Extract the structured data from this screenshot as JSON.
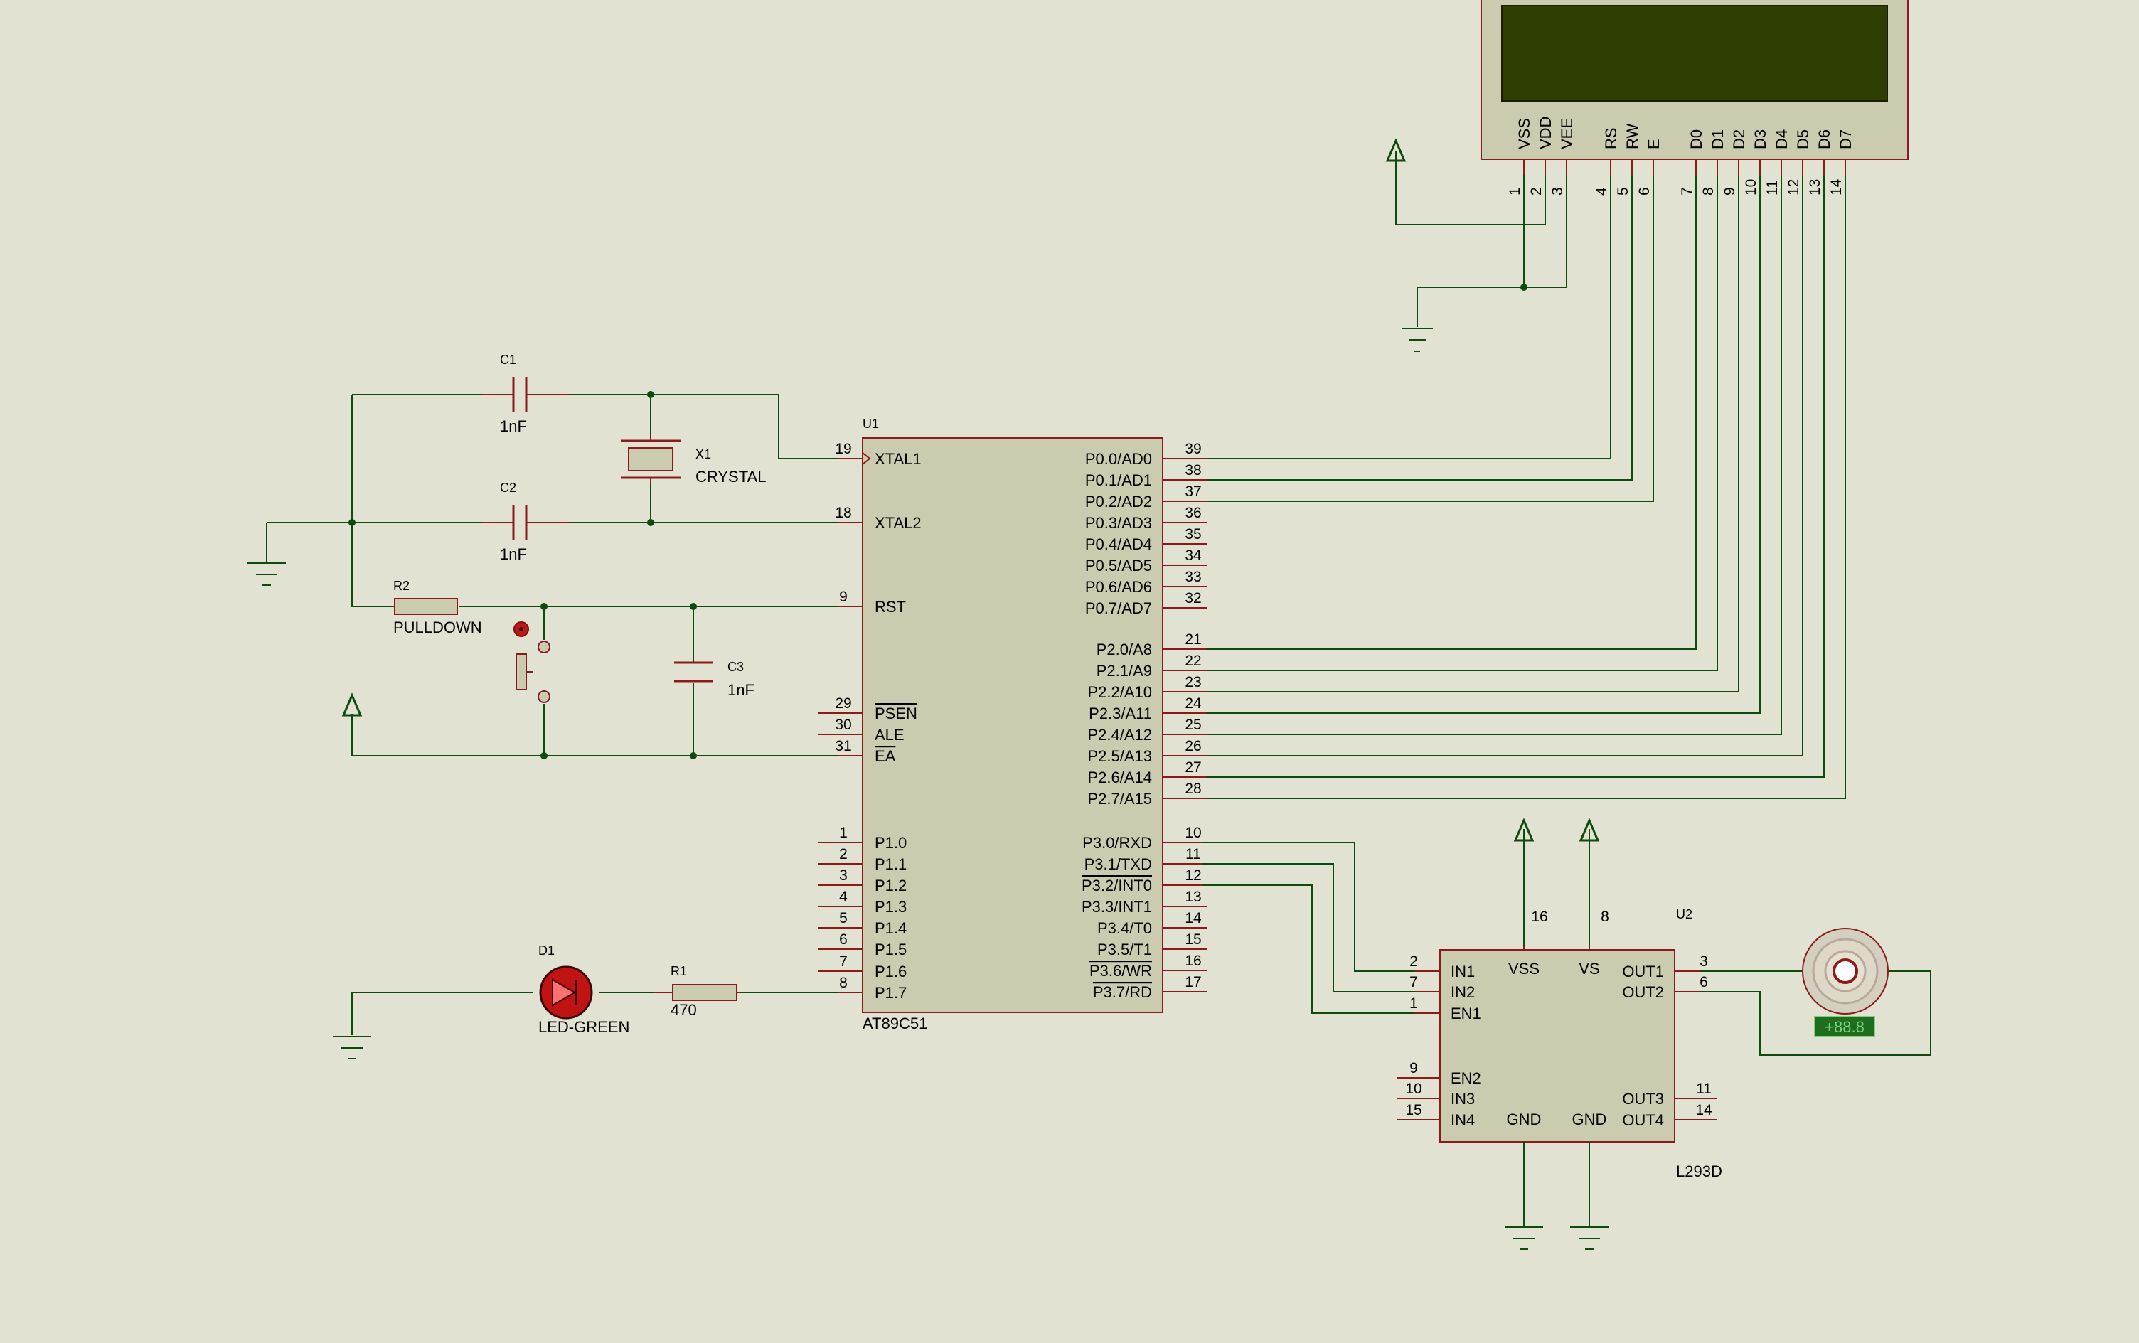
{
  "u1": {
    "ref": "U1",
    "part": "AT89C51",
    "left_pins": [
      {
        "num": "19",
        "name": "XTAL1"
      },
      {
        "num": "18",
        "name": "XTAL2"
      },
      {
        "num": "9",
        "name": "RST"
      },
      {
        "num": "29",
        "name": "PSEN"
      },
      {
        "num": "30",
        "name": "ALE"
      },
      {
        "num": "31",
        "name": "EA"
      },
      {
        "num": "1",
        "name": "P1.0"
      },
      {
        "num": "2",
        "name": "P1.1"
      },
      {
        "num": "3",
        "name": "P1.2"
      },
      {
        "num": "4",
        "name": "P1.3"
      },
      {
        "num": "5",
        "name": "P1.4"
      },
      {
        "num": "6",
        "name": "P1.5"
      },
      {
        "num": "7",
        "name": "P1.6"
      },
      {
        "num": "8",
        "name": "P1.7"
      }
    ],
    "right_pins": [
      {
        "num": "39",
        "name": "P0.0/AD0"
      },
      {
        "num": "38",
        "name": "P0.1/AD1"
      },
      {
        "num": "37",
        "name": "P0.2/AD2"
      },
      {
        "num": "36",
        "name": "P0.3/AD3"
      },
      {
        "num": "35",
        "name": "P0.4/AD4"
      },
      {
        "num": "34",
        "name": "P0.5/AD5"
      },
      {
        "num": "33",
        "name": "P0.6/AD6"
      },
      {
        "num": "32",
        "name": "P0.7/AD7"
      },
      {
        "num": "21",
        "name": "P2.0/A8"
      },
      {
        "num": "22",
        "name": "P2.1/A9"
      },
      {
        "num": "23",
        "name": "P2.2/A10"
      },
      {
        "num": "24",
        "name": "P2.3/A11"
      },
      {
        "num": "25",
        "name": "P2.4/A12"
      },
      {
        "num": "26",
        "name": "P2.5/A13"
      },
      {
        "num": "27",
        "name": "P2.6/A14"
      },
      {
        "num": "28",
        "name": "P2.7/A15"
      },
      {
        "num": "10",
        "name": "P3.0/RXD"
      },
      {
        "num": "11",
        "name": "P3.1/TXD"
      },
      {
        "num": "12",
        "name": "P3.2/INT0"
      },
      {
        "num": "13",
        "name": "P3.3/INT1"
      },
      {
        "num": "14",
        "name": "P3.4/T0"
      },
      {
        "num": "15",
        "name": "P3.5/T1"
      },
      {
        "num": "16",
        "name": "P3.6/WR"
      },
      {
        "num": "17",
        "name": "P3.7/RD"
      }
    ]
  },
  "u2": {
    "ref": "U2",
    "part": "L293D",
    "left_pins": [
      {
        "num": "2",
        "name": "IN1"
      },
      {
        "num": "7",
        "name": "IN2"
      },
      {
        "num": "1",
        "name": "EN1"
      },
      {
        "num": "9",
        "name": "EN2"
      },
      {
        "num": "10",
        "name": "IN3"
      },
      {
        "num": "15",
        "name": "IN4"
      }
    ],
    "right_pins": [
      {
        "num": "3",
        "name": "OUT1"
      },
      {
        "num": "6",
        "name": "OUT2"
      },
      {
        "num": "11",
        "name": "OUT3"
      },
      {
        "num": "14",
        "name": "OUT4"
      }
    ],
    "top_pins": [
      {
        "num": "16",
        "name": "VSS"
      },
      {
        "num": "8",
        "name": "VS"
      }
    ],
    "bottom_labels": [
      "GND",
      "GND"
    ]
  },
  "lcd": {
    "pins": [
      {
        "num": "1",
        "name": "VSS"
      },
      {
        "num": "2",
        "name": "VDD"
      },
      {
        "num": "3",
        "name": "VEE"
      },
      {
        "num": "4",
        "name": "RS"
      },
      {
        "num": "5",
        "name": "RW"
      },
      {
        "num": "6",
        "name": "E"
      },
      {
        "num": "7",
        "name": "D0"
      },
      {
        "num": "8",
        "name": "D1"
      },
      {
        "num": "9",
        "name": "D2"
      },
      {
        "num": "10",
        "name": "D3"
      },
      {
        "num": "11",
        "name": "D4"
      },
      {
        "num": "12",
        "name": "D5"
      },
      {
        "num": "13",
        "name": "D6"
      },
      {
        "num": "14",
        "name": "D7"
      }
    ]
  },
  "parts": {
    "c1": {
      "ref": "C1",
      "value": "1nF"
    },
    "c2": {
      "ref": "C2",
      "value": "1nF"
    },
    "c3": {
      "ref": "C3",
      "value": "1nF"
    },
    "x1": {
      "ref": "X1",
      "value": "CRYSTAL"
    },
    "r2": {
      "ref": "R2",
      "value": "PULLDOWN"
    },
    "r1": {
      "ref": "R1",
      "value": "470"
    },
    "d1": {
      "ref": "D1",
      "value": "LED-GREEN"
    },
    "motor_display": "+88.8"
  },
  "colors": {
    "background": "#e2e2d2",
    "wire": "#0f4a0f",
    "component": "#8c1a1a",
    "ic_body": "#cbcbaf",
    "lcd_screen": "#2e3d00"
  }
}
